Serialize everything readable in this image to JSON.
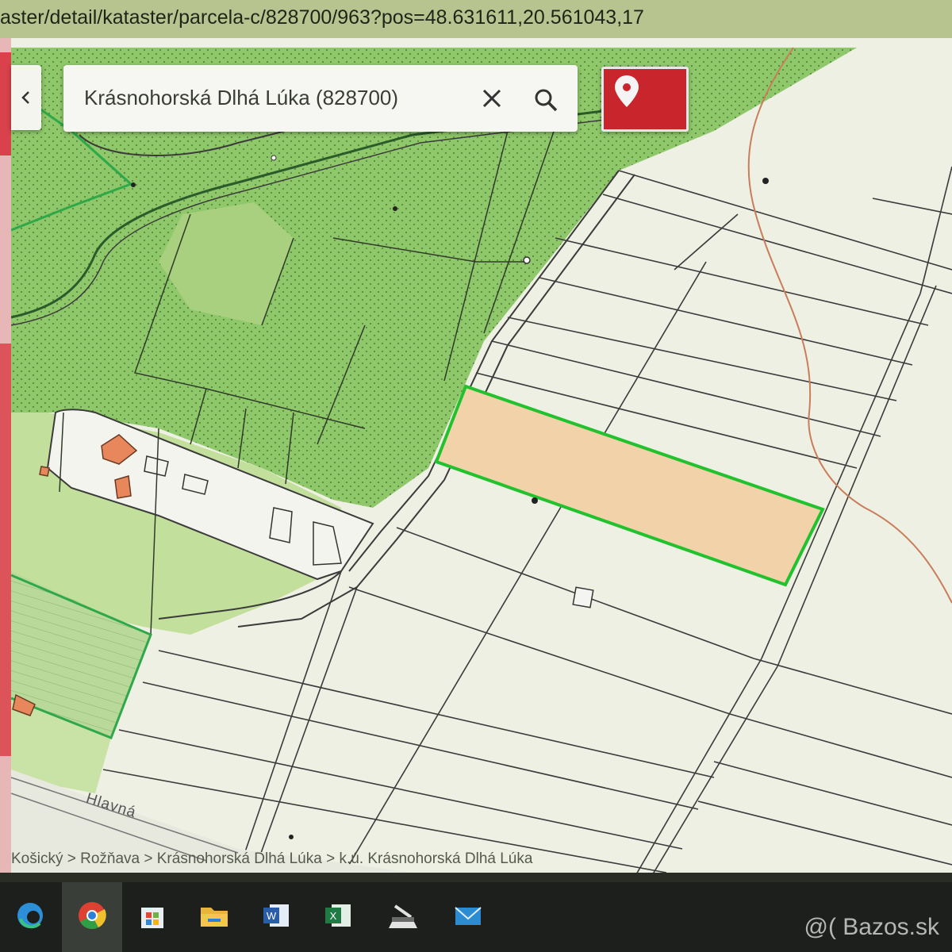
{
  "browser": {
    "url": "aster/detail/kataster/parcela-c/828700/963?pos=48.631611,20.561043,17"
  },
  "search": {
    "query": "Krásnohorská Dlhá Lúka (828700)"
  },
  "map": {
    "street_label": "Hlavná",
    "highlight_color": "#f2d3a9",
    "forest_color": "#8fc86a",
    "meadow_color": "#c9e2a6"
  },
  "breadcrumb": {
    "text": "Košický > Rožňava > Krásnohorská Dlhá Lúka > k.ú. Krásnohorská Dlhá Lúka"
  },
  "watermark": "@( Bazos.sk",
  "icons": {
    "back": "chevron-left-icon",
    "clear": "close-icon",
    "search": "search-icon",
    "marker": "map-pin-icon"
  }
}
